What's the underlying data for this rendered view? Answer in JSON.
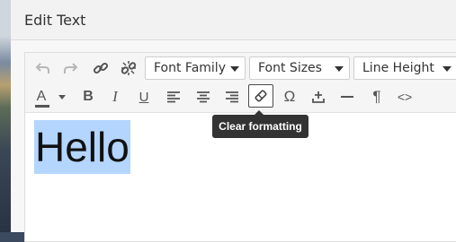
{
  "dialog": {
    "title": "Edit Text"
  },
  "toolbar": {
    "font_family": "Font Family",
    "font_sizes": "Font Sizes",
    "line_height": "Line Height",
    "text_color_letter": "A",
    "bold": "B",
    "italic": "I",
    "underline": "U",
    "omega": "Ω",
    "paragraph": "¶",
    "code": "<>"
  },
  "tooltip": {
    "text": "Clear formatting"
  },
  "editor": {
    "content": "Hello"
  }
}
